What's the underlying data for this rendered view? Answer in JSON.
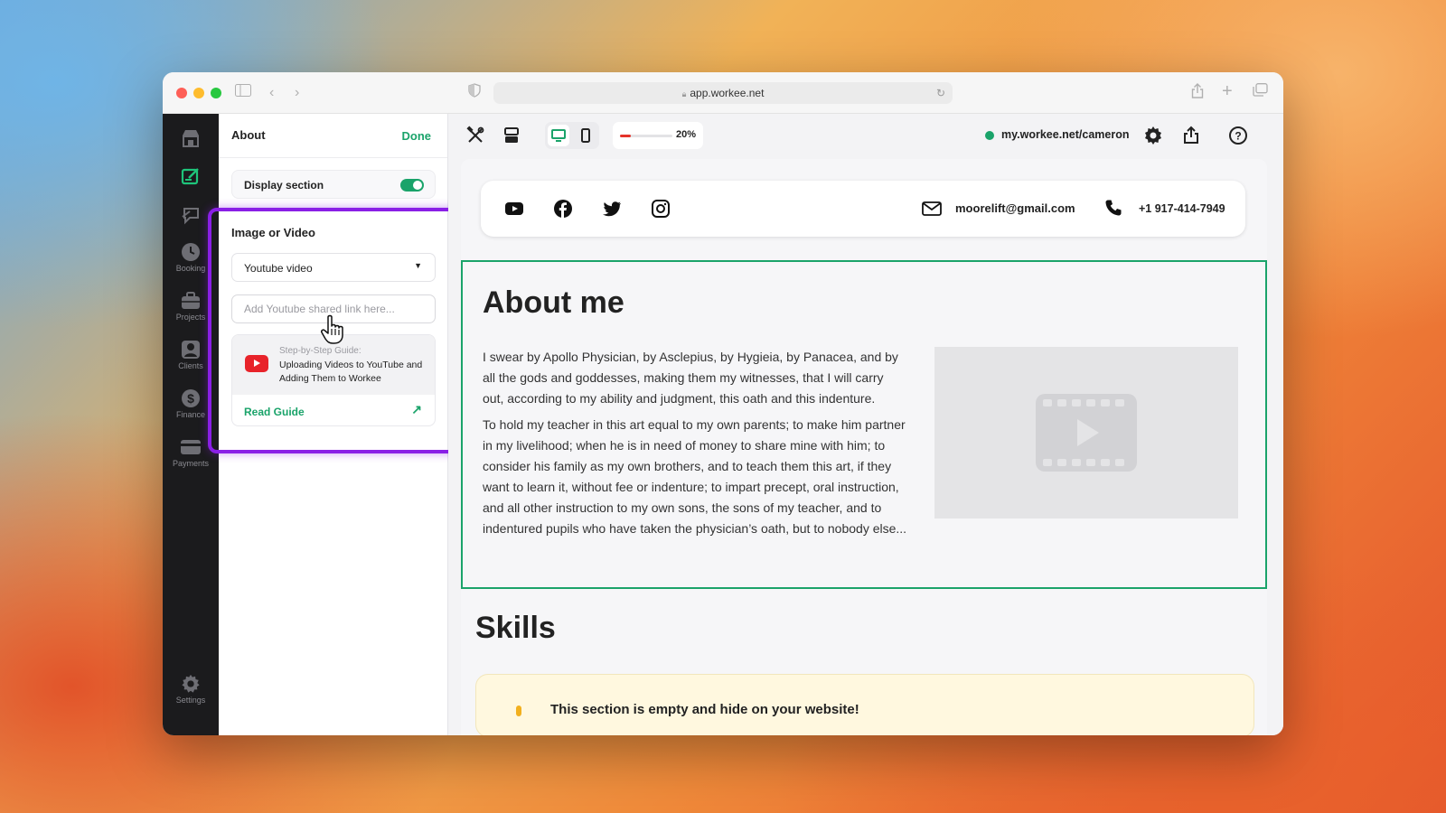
{
  "browser": {
    "url": "app.workee.net"
  },
  "sidebar": {
    "items": [
      {
        "label": "",
        "icon": "store-icon"
      },
      {
        "label": "",
        "icon": "edit-site-icon"
      },
      {
        "label": "",
        "icon": "chat-icon"
      },
      {
        "label": "Booking",
        "icon": "clock-icon"
      },
      {
        "label": "Projects",
        "icon": "briefcase-icon"
      },
      {
        "label": "Clients",
        "icon": "person-icon"
      },
      {
        "label": "Finance",
        "icon": "dollar-icon"
      },
      {
        "label": "Payments",
        "icon": "card-icon"
      }
    ],
    "settings_label": "Settings"
  },
  "panel": {
    "title": "About",
    "done_label": "Done",
    "display_section_label": "Display section",
    "display_section_on": true,
    "media_section_title": "Image or Video",
    "media_type_value": "Youtube video",
    "link_placeholder": "Add Youtube shared link here...",
    "guide": {
      "kicker": "Step-by-Step Guide:",
      "title": "Uploading Videos to YouTube and Adding Them to Workee",
      "link_label": "Read Guide"
    }
  },
  "toolbar": {
    "progress_percent": 20,
    "progress_label": "20%",
    "site_url": "my.workee.net/cameron",
    "site_status_color": "#1aa36a"
  },
  "site": {
    "contact": {
      "email": "moorelift@gmail.com",
      "phone": "+1 917-414-7949"
    },
    "about": {
      "heading": "About me",
      "paragraph_1": "I swear by Apollo Physician, by Asclepius, by Hygieia, by Panacea, and by all the gods and goddesses, making them my witnesses, that I will carry out, according to my ability and judgment, this oath and this indenture.",
      "paragraph_2": "To hold my teacher in this art equal to my own parents; to make him partner in my livelihood; when he is in need of money to share mine with him; to consider his family as my own brothers, and to teach them this art, if they want to learn it, without fee or indenture; to impart precept, oral instruction, and all other instruction to my own sons, the sons of my teacher, and to indentured pupils who have taken the physician’s oath, but to nobody else..."
    },
    "skills": {
      "heading": "Skills",
      "empty_message": "This section is empty and hide on your website!"
    }
  },
  "colors": {
    "accent": "#1aa36a",
    "highlight": "#8a1fe6",
    "youtube": "#e8232a"
  }
}
